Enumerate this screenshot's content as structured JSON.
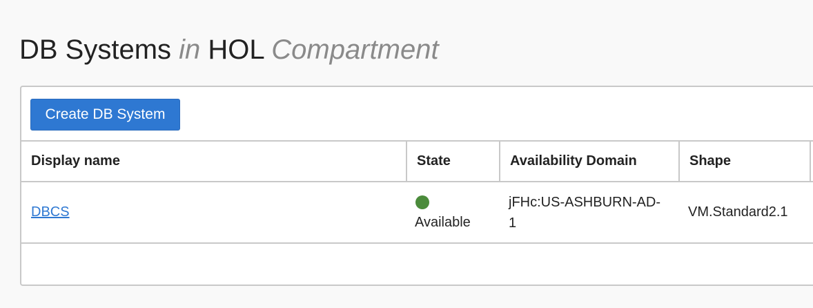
{
  "header": {
    "title_part1": "DB Systems ",
    "title_in": "in",
    "title_compartment_name": " HOL ",
    "title_compartment_word": "Compartment"
  },
  "toolbar": {
    "create_label": "Create DB System"
  },
  "table": {
    "columns": [
      "Display name",
      "State",
      "Availability Domain",
      "Shape"
    ],
    "rows": [
      {
        "display_name": "DBCS",
        "state": "Available",
        "state_color": "#4b8b3b",
        "availability_domain": "jFHc:US-ASHBURN-AD-1",
        "shape": "VM.Standard2.1"
      }
    ]
  },
  "colors": {
    "accent": "#2e78d2",
    "status_available": "#4b8b3b"
  }
}
